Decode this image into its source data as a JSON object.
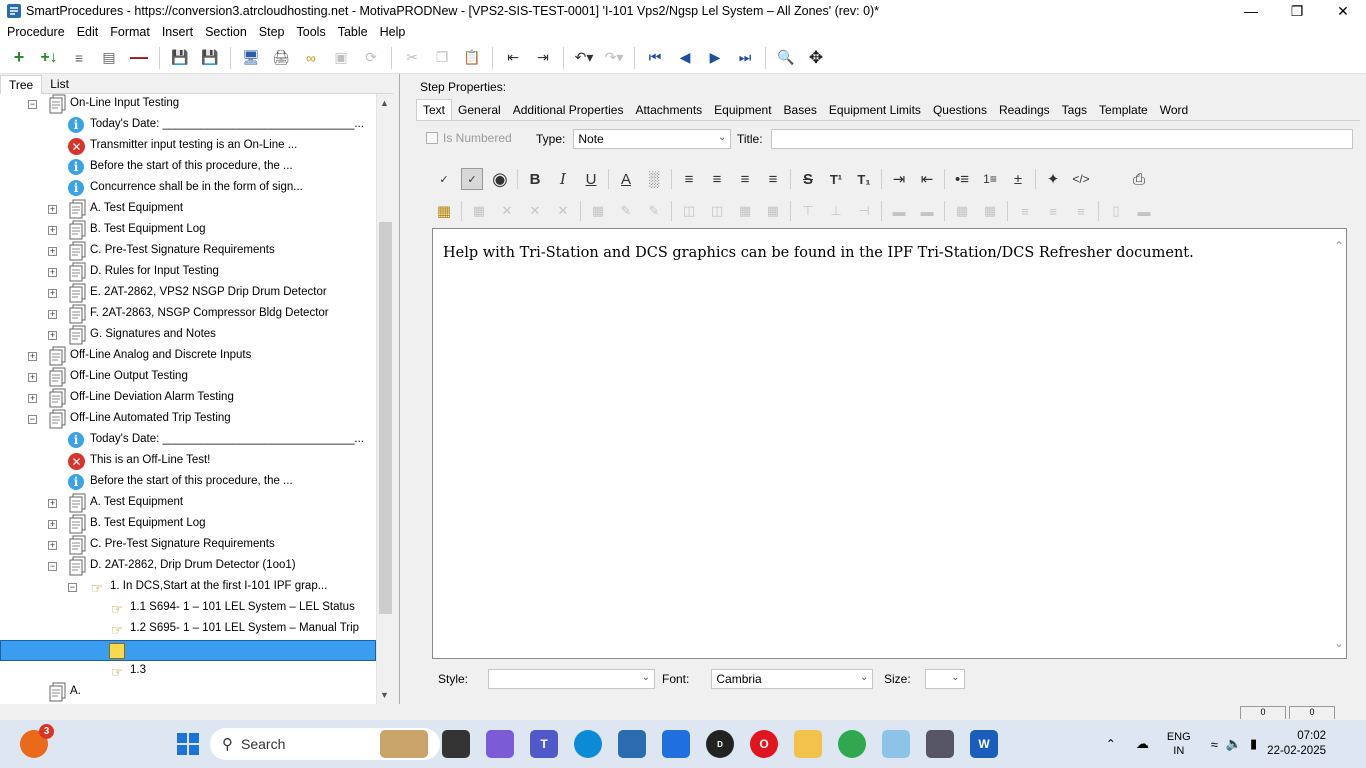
{
  "window": {
    "title": "SmartProcedures - https://conversion3.atrcloudhosting.net - MotivaPRODNew - [VPS2-SIS-TEST-0001] 'I-101 Vps2/Ngsp Lel System – All Zones' (rev: 0)*"
  },
  "menu": [
    "Procedure",
    "Edit",
    "Format",
    "Insert",
    "Section",
    "Step",
    "Tools",
    "Table",
    "Help"
  ],
  "left_tabs": [
    "Tree",
    "List"
  ],
  "tree": [
    {
      "label": "On-Line Input Testing",
      "icon": "doc",
      "level": 1,
      "exp": "-"
    },
    {
      "label": "Today's Date: ______________________________...",
      "icon": "info",
      "level": 2
    },
    {
      "label": "Transmitter input testing is an On-Line ...",
      "icon": "err",
      "level": 2
    },
    {
      "label": "Before the start of this procedure, the ...",
      "icon": "info",
      "level": 2
    },
    {
      "label": "Concurrence shall be in the form of sign...",
      "icon": "info",
      "level": 2
    },
    {
      "label": "A. Test Equipment",
      "icon": "doc",
      "level": 2,
      "exp": "+"
    },
    {
      "label": "B. Test Equipment Log",
      "icon": "doc",
      "level": 2,
      "exp": "+"
    },
    {
      "label": "C. Pre-Test Signature Requirements",
      "icon": "doc",
      "level": 2,
      "exp": "+"
    },
    {
      "label": "D. Rules for Input Testing",
      "icon": "doc",
      "level": 2,
      "exp": "+"
    },
    {
      "label": "E. 2AT-2862, VPS2 NSGP Drip Drum Detector",
      "icon": "doc",
      "level": 2,
      "exp": "+"
    },
    {
      "label": "F. 2AT-2863, NSGP Compressor Bldg Detector",
      "icon": "doc",
      "level": 2,
      "exp": "+"
    },
    {
      "label": "G. Signatures and Notes",
      "icon": "doc",
      "level": 2,
      "exp": "+"
    },
    {
      "label": "Off-Line Analog and Discrete Inputs",
      "icon": "doc",
      "level": 1,
      "exp": "+"
    },
    {
      "label": "Off-Line Output Testing",
      "icon": "doc",
      "level": 1,
      "exp": "+"
    },
    {
      "label": "Off-Line Deviation Alarm Testing",
      "icon": "doc",
      "level": 1,
      "exp": "+"
    },
    {
      "label": "Off-Line Automated Trip Testing",
      "icon": "doc",
      "level": 1,
      "exp": "-"
    },
    {
      "label": "Today's Date: ______________________________...",
      "icon": "info",
      "level": 2
    },
    {
      "label": "This is an Off-Line Test!",
      "icon": "err",
      "level": 2
    },
    {
      "label": "Before the start of this procedure, the ...",
      "icon": "info",
      "level": 2
    },
    {
      "label": "A. Test Equipment",
      "icon": "doc",
      "level": 2,
      "exp": "+"
    },
    {
      "label": "B. Test Equipment Log",
      "icon": "doc",
      "level": 2,
      "exp": "+"
    },
    {
      "label": "C. Pre-Test Signature Requirements",
      "icon": "doc",
      "level": 2,
      "exp": "+"
    },
    {
      "label": "D. 2AT-2862, Drip Drum Detector (1oo1)",
      "icon": "doc",
      "level": 2,
      "exp": "-"
    },
    {
      "label": "1. In DCS,Start at the first I-101 IPF grap...",
      "icon": "hand",
      "level": 3,
      "exp": "-"
    },
    {
      "label": "1.1 S694- 1 – 101 LEL System – LEL Status",
      "icon": "hand",
      "level": 4
    },
    {
      "label": "1.2 S695- 1 – 101 LEL System – Manual Trip",
      "icon": "hand",
      "level": 4
    },
    {
      "label": "",
      "icon": "note",
      "level": 4,
      "selected": true
    },
    {
      "label": "1.3",
      "icon": "hand",
      "level": 4
    },
    {
      "label": "A.",
      "icon": "doc",
      "level": 1
    }
  ],
  "step_properties": {
    "label": "Step Properties:",
    "tabs": [
      "Text",
      "General",
      "Additional Properties",
      "Attachments",
      "Equipment",
      "Bases",
      "Equipment Limits",
      "Questions",
      "Readings",
      "Tags",
      "Template",
      "Word"
    ],
    "is_numbered_label": "Is Numbered",
    "type_label": "Type:",
    "type_value": "Note",
    "title_label": "Title:",
    "title_value": "",
    "editor_text": "Help with Tri-Station and DCS graphics can be found in the IPF Tri-Station/DCS Refresher document.",
    "style_label": "Style:",
    "style_value": "",
    "font_label": "Font:",
    "font_value": "Cambria",
    "size_label": "Size:",
    "size_value": ""
  },
  "status_boxes": [
    "0",
    "0"
  ],
  "taskbar": {
    "search_label": "Search",
    "notification_count": "3",
    "lang_line1": "ENG",
    "lang_line2": "IN",
    "time": "07:02",
    "date": "22-02-2025"
  }
}
